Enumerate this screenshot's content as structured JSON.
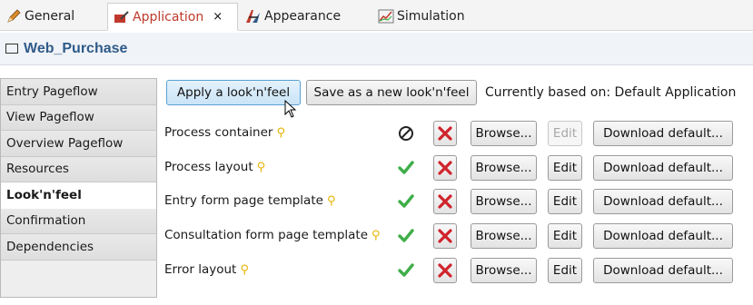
{
  "tabs": [
    {
      "label": "General",
      "icon": "pencil-icon"
    },
    {
      "label": "Application",
      "icon": "application-icon",
      "close": "×"
    },
    {
      "label": "Appearance",
      "icon": "appearance-icon"
    },
    {
      "label": "Simulation",
      "icon": "simulation-chart-icon"
    }
  ],
  "title": "Web_Purchase",
  "sidebar": {
    "items": [
      {
        "label": "Entry Pageflow"
      },
      {
        "label": "View Pageflow"
      },
      {
        "label": "Overview Pageflow"
      },
      {
        "label": "Resources"
      },
      {
        "label": "Look'n'feel",
        "active": true
      },
      {
        "label": "Confirmation"
      },
      {
        "label": "Dependencies"
      }
    ]
  },
  "toolbar": {
    "apply_label": "Apply a look'n'feel",
    "save_label": "Save as a new look'n'feel",
    "based_on": "Currently based on: Default Application"
  },
  "rows": [
    {
      "label": "Process container",
      "status": "none",
      "browse": "Browse...",
      "edit": "Edit",
      "edit_disabled": true,
      "download": "Download default..."
    },
    {
      "label": "Process layout",
      "status": "ok",
      "browse": "Browse...",
      "edit": "Edit",
      "edit_disabled": false,
      "download": "Download default..."
    },
    {
      "label": "Entry form page template",
      "status": "ok",
      "browse": "Browse...",
      "edit": "Edit",
      "edit_disabled": false,
      "download": "Download default..."
    },
    {
      "label": "Consultation form page template",
      "status": "ok",
      "browse": "Browse...",
      "edit": "Edit",
      "edit_disabled": false,
      "download": "Download default..."
    },
    {
      "label": "Error layout",
      "status": "ok",
      "browse": "Browse...",
      "edit": "Edit",
      "edit_disabled": false,
      "download": "Download default..."
    }
  ],
  "colors": {
    "accent_tab": "#c0392b",
    "title": "#2f5b8a",
    "check": "#3fae49",
    "delete": "#d0232b",
    "bulb": "#e6b400"
  }
}
